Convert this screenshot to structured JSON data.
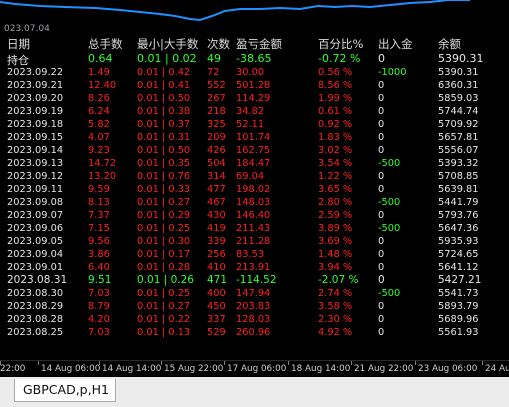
{
  "chart": {
    "start_date": "023.07.04",
    "colors": {
      "equity_line": "#1e90ff",
      "green": "#33ff33",
      "red": "#ff2020",
      "white": "#e6e6e6",
      "header": "#dcdcdc"
    }
  },
  "table": {
    "headers": {
      "date": "日期",
      "lots": "总手数",
      "range": "最小|大手数",
      "count": "次数",
      "pnl": "盈亏金额",
      "pct": "百分比%",
      "flow": "出入金",
      "balance": "余额"
    },
    "holding": {
      "label": "持仓",
      "lots": "0.64",
      "range": "0.01 | 0.02",
      "count": "49",
      "pnl": "-38.65",
      "pct": "-0.72 %",
      "flow": "0",
      "balance": "5390.31"
    },
    "rows": [
      {
        "date": "2023.09.22",
        "lots": "1.49",
        "range": "0.01 | 0.42",
        "count": "72",
        "pnl": "30.00",
        "pct": "0.56 %",
        "flow": "-1000",
        "balance": "5390.31",
        "color": "red"
      },
      {
        "date": "2023.09.21",
        "lots": "12.40",
        "range": "0.01 | 0.41",
        "count": "552",
        "pnl": "501.28",
        "pct": "8.56 %",
        "flow": "0",
        "balance": "6360.31",
        "color": "red"
      },
      {
        "date": "2023.09.20",
        "lots": "8.26",
        "range": "0.01 | 0.50",
        "count": "267",
        "pnl": "114.29",
        "pct": "1.99 %",
        "flow": "0",
        "balance": "5859.03",
        "color": "red"
      },
      {
        "date": "2023.09.19",
        "lots": "6.24",
        "range": "0.01 | 0.38",
        "count": "218",
        "pnl": "34.82",
        "pct": "0.61 %",
        "flow": "0",
        "balance": "5744.74",
        "color": "red"
      },
      {
        "date": "2023.09.18",
        "lots": "5.82",
        "range": "0.01 | 0.37",
        "count": "325",
        "pnl": "52.11",
        "pct": "0.92 %",
        "flow": "0",
        "balance": "5709.92",
        "color": "red"
      },
      {
        "date": "2023.09.15",
        "lots": "4.07",
        "range": "0.01 | 0.31",
        "count": "209",
        "pnl": "101.74",
        "pct": "1.83 %",
        "flow": "0",
        "balance": "5657.81",
        "color": "red"
      },
      {
        "date": "2023.09.14",
        "lots": "9.23",
        "range": "0.01 | 0.50",
        "count": "426",
        "pnl": "162.75",
        "pct": "3.02 %",
        "flow": "0",
        "balance": "5556.07",
        "color": "red"
      },
      {
        "date": "2023.09.13",
        "lots": "14.72",
        "range": "0.01 | 0.35",
        "count": "504",
        "pnl": "184.47",
        "pct": "3.54 %",
        "flow": "-500",
        "balance": "5393.32",
        "color": "red"
      },
      {
        "date": "2023.09.12",
        "lots": "13.20",
        "range": "0.01 | 0.76",
        "count": "314",
        "pnl": "69.04",
        "pct": "1.22 %",
        "flow": "0",
        "balance": "5708.85",
        "color": "red"
      },
      {
        "date": "2023.09.11",
        "lots": "9.59",
        "range": "0.01 | 0.33",
        "count": "477",
        "pnl": "198.02",
        "pct": "3.65 %",
        "flow": "0",
        "balance": "5639.81",
        "color": "red"
      },
      {
        "date": "2023.09.08",
        "lots": "8.13",
        "range": "0.01 | 0.27",
        "count": "467",
        "pnl": "148.03",
        "pct": "2.80 %",
        "flow": "-500",
        "balance": "5441.79",
        "color": "red"
      },
      {
        "date": "2023.09.07",
        "lots": "7.37",
        "range": "0.01 | 0.29",
        "count": "430",
        "pnl": "146.40",
        "pct": "2.59 %",
        "flow": "0",
        "balance": "5793.76",
        "color": "red"
      },
      {
        "date": "2023.09.06",
        "lots": "7.15",
        "range": "0.01 | 0.25",
        "count": "419",
        "pnl": "211.43",
        "pct": "3.89 %",
        "flow": "-500",
        "balance": "5647.36",
        "color": "red"
      },
      {
        "date": "2023.09.05",
        "lots": "9.56",
        "range": "0.01 | 0.30",
        "count": "339",
        "pnl": "211.28",
        "pct": "3.69 %",
        "flow": "0",
        "balance": "5935.93",
        "color": "red"
      },
      {
        "date": "2023.09.04",
        "lots": "3.86",
        "range": "0.01 | 0.17",
        "count": "256",
        "pnl": "83.53",
        "pct": "1.48 %",
        "flow": "0",
        "balance": "5724.65",
        "color": "red"
      },
      {
        "date": "2023.09.01",
        "lots": "6.40",
        "range": "0.01 | 0.28",
        "count": "410",
        "pnl": "213.91",
        "pct": "3.94 %",
        "flow": "0",
        "balance": "5641.12",
        "color": "red"
      },
      {
        "date": "2023.08.31",
        "lots": "9.51",
        "range": "0.01 | 0.26",
        "count": "471",
        "pnl": "-114.52",
        "pct": "-2.07 %",
        "flow": "0",
        "balance": "5427.21",
        "color": "green"
      },
      {
        "date": "2023.08.30",
        "lots": "7.03",
        "range": "0.01 | 0.25",
        "count": "400",
        "pnl": "147.94",
        "pct": "2.74 %",
        "flow": "-500",
        "balance": "5541.73",
        "color": "red"
      },
      {
        "date": "2023.08.29",
        "lots": "8.79",
        "range": "0.01 | 0.27",
        "count": "450",
        "pnl": "203.83",
        "pct": "3.58 %",
        "flow": "0",
        "balance": "5893.79",
        "color": "red"
      },
      {
        "date": "2023.08.28",
        "lots": "4.20",
        "range": "0.01 | 0.22",
        "count": "337",
        "pnl": "128.03",
        "pct": "2.30 %",
        "flow": "0",
        "balance": "5689.96",
        "color": "red"
      },
      {
        "date": "2023.08.25",
        "lots": "7.03",
        "range": "0.01 | 0.13",
        "count": "529",
        "pnl": "260.96",
        "pct": "4.92 %",
        "flow": "0",
        "balance": "5561.93",
        "color": "red"
      }
    ]
  },
  "time_axis": {
    "labels": [
      "22:00",
      "14 Aug 06:00",
      "14 Aug 14:00",
      "15 Aug 22:00",
      "17 Aug 06:00",
      "18 Aug 14:00",
      "21 Aug 22:00",
      "23 Aug 06:00",
      "24 Aug"
    ]
  },
  "tabs": [
    {
      "label": "GBPCAD,p,H1",
      "active": true
    }
  ]
}
